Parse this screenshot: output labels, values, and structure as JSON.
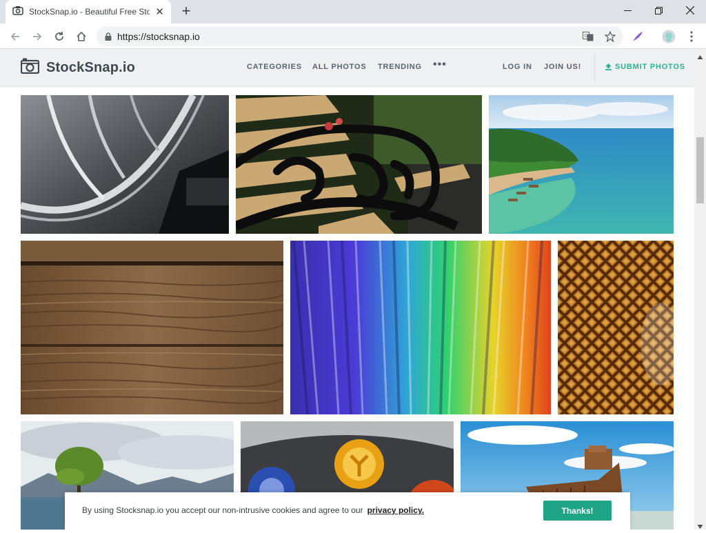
{
  "browser": {
    "tab_title": "StockSnap.io - Beautiful Free Sto",
    "url": "https://stocksnap.io"
  },
  "header": {
    "logo_text": "StockSnap.io",
    "nav": {
      "categories": "CATEGORIES",
      "all_photos": "ALL PHOTOS",
      "trending": "TRENDING",
      "more": "•••"
    },
    "login": "LOG IN",
    "join": "JOIN US!",
    "submit": "SUBMIT PHOTOS"
  },
  "photos": [
    {
      "name": "photo-headlight"
    },
    {
      "name": "photo-bench"
    },
    {
      "name": "photo-tropical-coast"
    },
    {
      "name": "photo-wood-planks"
    },
    {
      "name": "photo-rainbow-light"
    },
    {
      "name": "photo-metal-mesh"
    },
    {
      "name": "photo-lake-tree"
    },
    {
      "name": "photo-gamepad-buttons"
    },
    {
      "name": "photo-shipwreck"
    }
  ],
  "cookie": {
    "text": "By using Stocksnap.io you accept our non-intrusive cookies and agree to our",
    "link": "privacy policy.",
    "button": "Thanks!"
  },
  "colors": {
    "accent": "#28b491",
    "cookie_button": "#1fa585"
  }
}
